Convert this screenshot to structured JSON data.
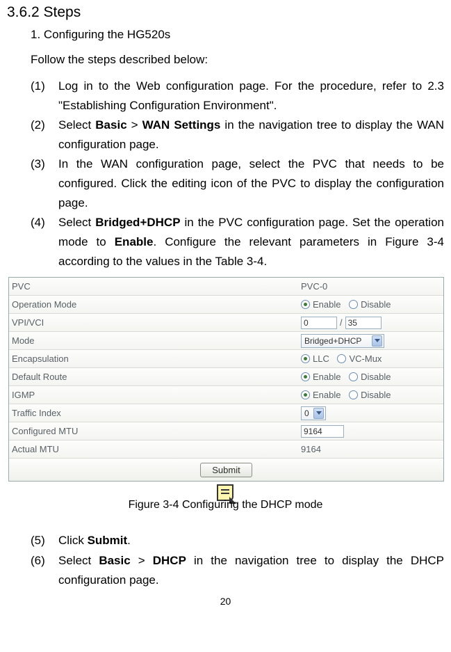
{
  "heading": "3.6.2  Steps",
  "subTitle": "1. Configuring the HG520s",
  "lead": "Follow the steps described below:",
  "steps": {
    "s1": {
      "marker": "(1)",
      "text": "Log in to the Web configuration page. For the procedure, refer to 2.3  \"Establishing Configuration Environment\"."
    },
    "s2": {
      "marker": "(2)",
      "pre": "Select ",
      "b1": "Basic",
      "mid1": " > ",
      "b2": "WAN Settings",
      "post": " in the navigation tree to display the WAN configuration page."
    },
    "s3": {
      "marker": "(3)",
      "text": "In the WAN configuration page, select the PVC that needs to be configured. Click the editing icon of the PVC to display the configuration page."
    },
    "s4": {
      "marker": "(4)",
      "pre": "Select ",
      "b1": "Bridged+DHCP",
      "mid1": " in the PVC configuration page. Set the operation mode to ",
      "b2": "Enable",
      "post": ". Configure the relevant parameters in Figure 3-4 according to the values in the Table 3-4."
    },
    "s5": {
      "marker": "(5)",
      "pre": "Click ",
      "b1": "Submit",
      "post": "."
    },
    "s6": {
      "marker": "(6)",
      "pre": "Select ",
      "b1": "Basic",
      "mid1": " > ",
      "b2": "DHCP",
      "post": " in the navigation tree to display the DHCP configuration page."
    }
  },
  "form": {
    "pvc": {
      "label": "PVC",
      "value": "PVC-0"
    },
    "opmode": {
      "label": "Operation Mode",
      "opt1": "Enable",
      "opt2": "Disable"
    },
    "vpivci": {
      "label": "VPI/VCI",
      "v1": "0",
      "sep": " / ",
      "v2": "35"
    },
    "mode": {
      "label": "Mode",
      "value": "Bridged+DHCP"
    },
    "encap": {
      "label": "Encapsulation",
      "opt1": "LLC",
      "opt2": "VC-Mux"
    },
    "droute": {
      "label": "Default Route",
      "opt1": "Enable",
      "opt2": "Disable"
    },
    "igmp": {
      "label": "IGMP",
      "opt1": "Enable",
      "opt2": "Disable"
    },
    "tindex": {
      "label": "Traffic Index",
      "value": "0"
    },
    "cmtu": {
      "label": "Configured MTU",
      "value": "9164"
    },
    "amtu": {
      "label": "Actual MTU",
      "value": "9164"
    },
    "submit": "Submit"
  },
  "figCaption": "Figure 3-4 Configuring the DHCP mode",
  "pageNum": "20"
}
